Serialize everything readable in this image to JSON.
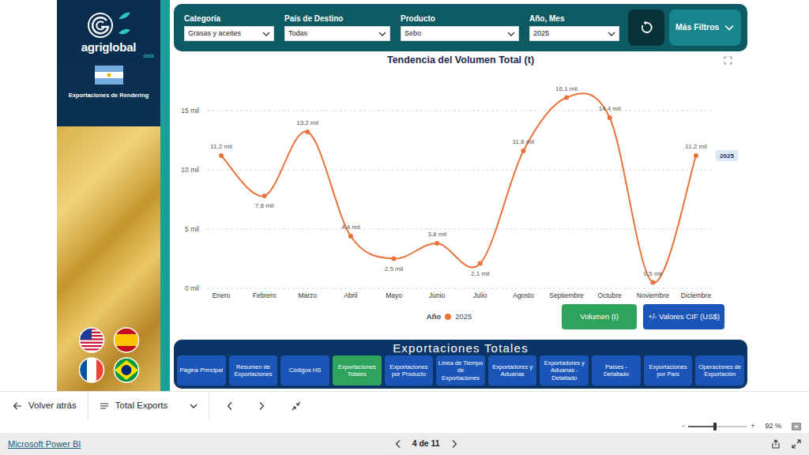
{
  "sidebar": {
    "brand": "agriglobal",
    "brand_sub": "data",
    "title": "Exportaciones de Rendering"
  },
  "filters": [
    {
      "label": "Categoría",
      "value": "Grasas y aceites"
    },
    {
      "label": "País de Destino",
      "value": "Todas"
    },
    {
      "label": "Producto",
      "value": "Sebo"
    },
    {
      "label": "Año, Mes",
      "value": "2025"
    }
  ],
  "more_filters": {
    "label": "Más Filtros"
  },
  "chart": {
    "title": "Tendencia del Volumen Total (t)",
    "y_ticks": [
      "0 mil",
      "5 mil",
      "10 mil",
      "15 mil"
    ],
    "y_tick_values": [
      0,
      5,
      10,
      15
    ],
    "x_labels": [
      "Enero",
      "Febrero",
      "Marzo",
      "Abril",
      "Mayo",
      "Junio",
      "Julio",
      "Agosto",
      "Septiembre",
      "Octubre",
      "Noviembre",
      "Diciembre"
    ],
    "series": [
      {
        "name": "2025",
        "color": "#e8743b",
        "values": [
          11.2,
          7.8,
          13.2,
          4.4,
          2.5,
          3.8,
          2.1,
          11.6,
          16.1,
          14.4,
          0.5,
          11.2
        ],
        "labels": [
          "11,2 mil",
          "7,8 mil",
          "13,2 mil",
          "4,4 mil",
          "2,5 mil",
          "3,8 mil",
          "2,1 mil",
          "11,6 mil",
          "16,1 mil",
          "14,4 mil",
          "0,5 mil",
          "11,2 mil"
        ]
      }
    ],
    "legend_title": "Año",
    "end_label": "2025"
  },
  "measure_buttons": [
    {
      "label": "Volumen (t)",
      "selected": true
    },
    {
      "label": "+/- Valores CIF (US$)",
      "selected": false
    }
  ],
  "nav": {
    "title": "Exportaciones Totales",
    "items": [
      {
        "label": "Página Principal",
        "selected": false
      },
      {
        "label": "Resumen de Exportaciones",
        "selected": false
      },
      {
        "label": "Códigos HS",
        "selected": false
      },
      {
        "label": "Exportaciones Totales",
        "selected": true
      },
      {
        "label": "Exportaciones por Producto",
        "selected": false
      },
      {
        "label": "Línea de Tiempo de Exportaciones",
        "selected": false
      },
      {
        "label": "Exportadores y Aduanas",
        "selected": false
      },
      {
        "label": "Exportadores y Aduanas - Detallado",
        "selected": false
      },
      {
        "label": "Países - Detallado",
        "selected": false
      },
      {
        "label": "Exportaciones por País",
        "selected": false
      },
      {
        "label": "Operaciones de Exportación",
        "selected": false
      }
    ]
  },
  "toolbar": {
    "back": "Volver atrás",
    "page": "Total Exports"
  },
  "zoom": {
    "minus": "-",
    "plus": "+",
    "reading": "92 %",
    "level": 0.46
  },
  "footer": {
    "brand": "Microsoft Power BI",
    "pages": "4 de 11"
  }
}
